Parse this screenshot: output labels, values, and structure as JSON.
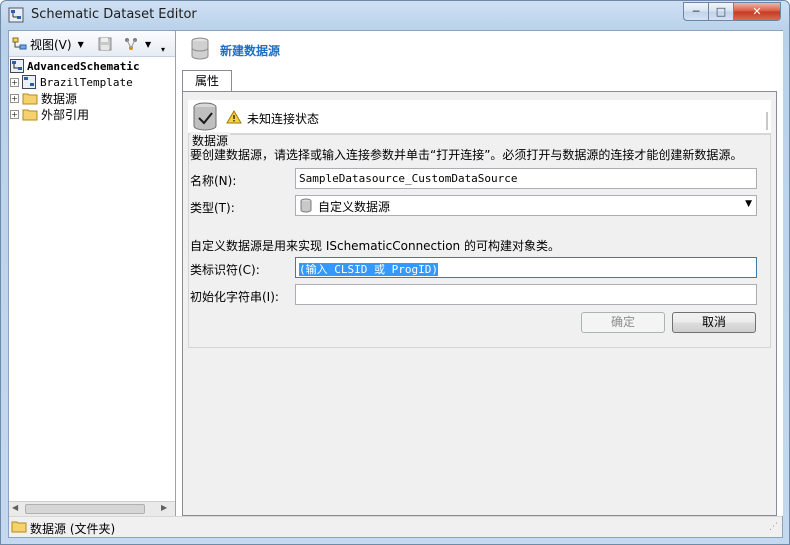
{
  "window": {
    "title": "Schematic Dataset Editor"
  },
  "toolbar": {
    "view_label": "视图(V)"
  },
  "tree": {
    "root": "AdvancedSchematic",
    "items": [
      {
        "label": "BrazilTemplate"
      },
      {
        "label": "数据源"
      },
      {
        "label": "外部引用"
      }
    ]
  },
  "header": {
    "title": "新建数据源"
  },
  "tabs": [
    {
      "label": "属性"
    }
  ],
  "status": {
    "text": "未知连接状态"
  },
  "group": {
    "title": "数据源",
    "description": "要创建数据源，请选择或输入连接参数并单击“打开连接”。必须打开与数据源的连接才能创建新数据源。",
    "name_label": "名称(N):",
    "name_value": "SampleDatasource_CustomDataSource",
    "type_label": "类型(T):",
    "type_value": "自定义数据源",
    "type_info": "自定义数据源是用来实现 ISchematicConnection 的可构建对象类。",
    "class_label": "类标识符(C):",
    "class_value": "(输入 CLSID 或 ProgID)",
    "init_label": "初始化字符串(I):",
    "init_value": "",
    "ok_label": "确定",
    "cancel_label": "取消"
  },
  "statusbar": {
    "text": "数据源 (文件夹)"
  }
}
